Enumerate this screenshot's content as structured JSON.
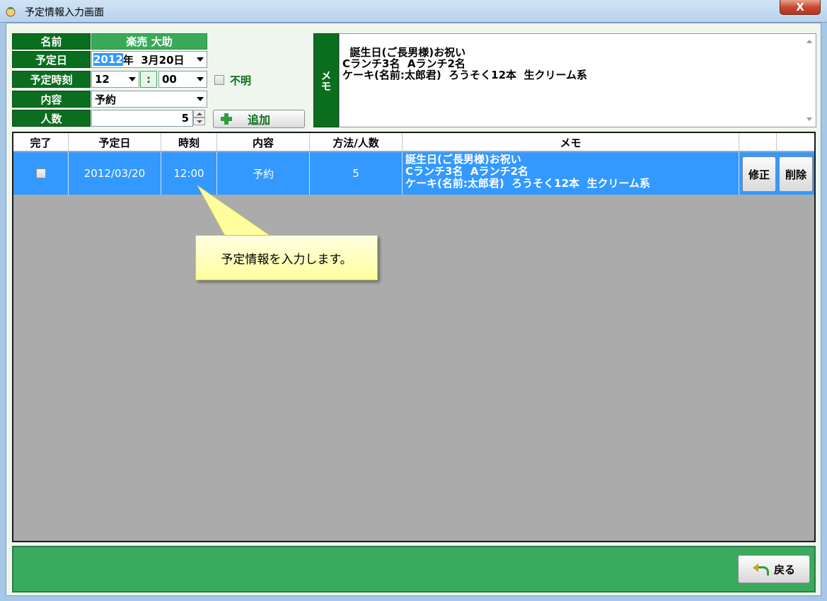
{
  "window": {
    "title": "予定情報入力画面",
    "close_label": "X"
  },
  "form": {
    "name_label": "名前",
    "name_value": "楽売 大助",
    "date_label": "予定日",
    "date_year": "2012",
    "date_rest": "年  3月20日",
    "time_label": "予定時刻",
    "hour_value": "12",
    "time_separator": ":",
    "minute_value": "00",
    "unknown_label": "不明",
    "content_label": "内容",
    "content_value": "予約",
    "count_label": "人数",
    "count_value": "5",
    "add_label": "追加"
  },
  "memo": {
    "label": "メモ",
    "text": "誕生日(ご長男様)お祝い\nCランチ3名  Aランチ2名\nケーキ(名前:太郎君)  ろうそく12本  生クリーム系"
  },
  "grid": {
    "headers": [
      "完了",
      "予定日",
      "時刻",
      "内容",
      "方法/人数",
      "メモ"
    ],
    "rows": [
      {
        "done": false,
        "date": "2012/03/20",
        "time": "12:00",
        "content": "予約",
        "count": "5",
        "memo": "誕生日(ご長男様)お祝い\nCランチ3名  Aランチ2名\nケーキ(名前:太郎君)  ろうそく12本  生クリーム系",
        "edit_label": "修正",
        "delete_label": "削除"
      }
    ]
  },
  "tooltip": {
    "text": "予定情報を入力します。"
  },
  "footer": {
    "back_label": "戻る"
  },
  "colors": {
    "label_green": "#0b6e1f",
    "accent_green": "#3aaa5a",
    "selection_blue": "#3399ff",
    "tooltip_yellow": "#ffff9e"
  }
}
